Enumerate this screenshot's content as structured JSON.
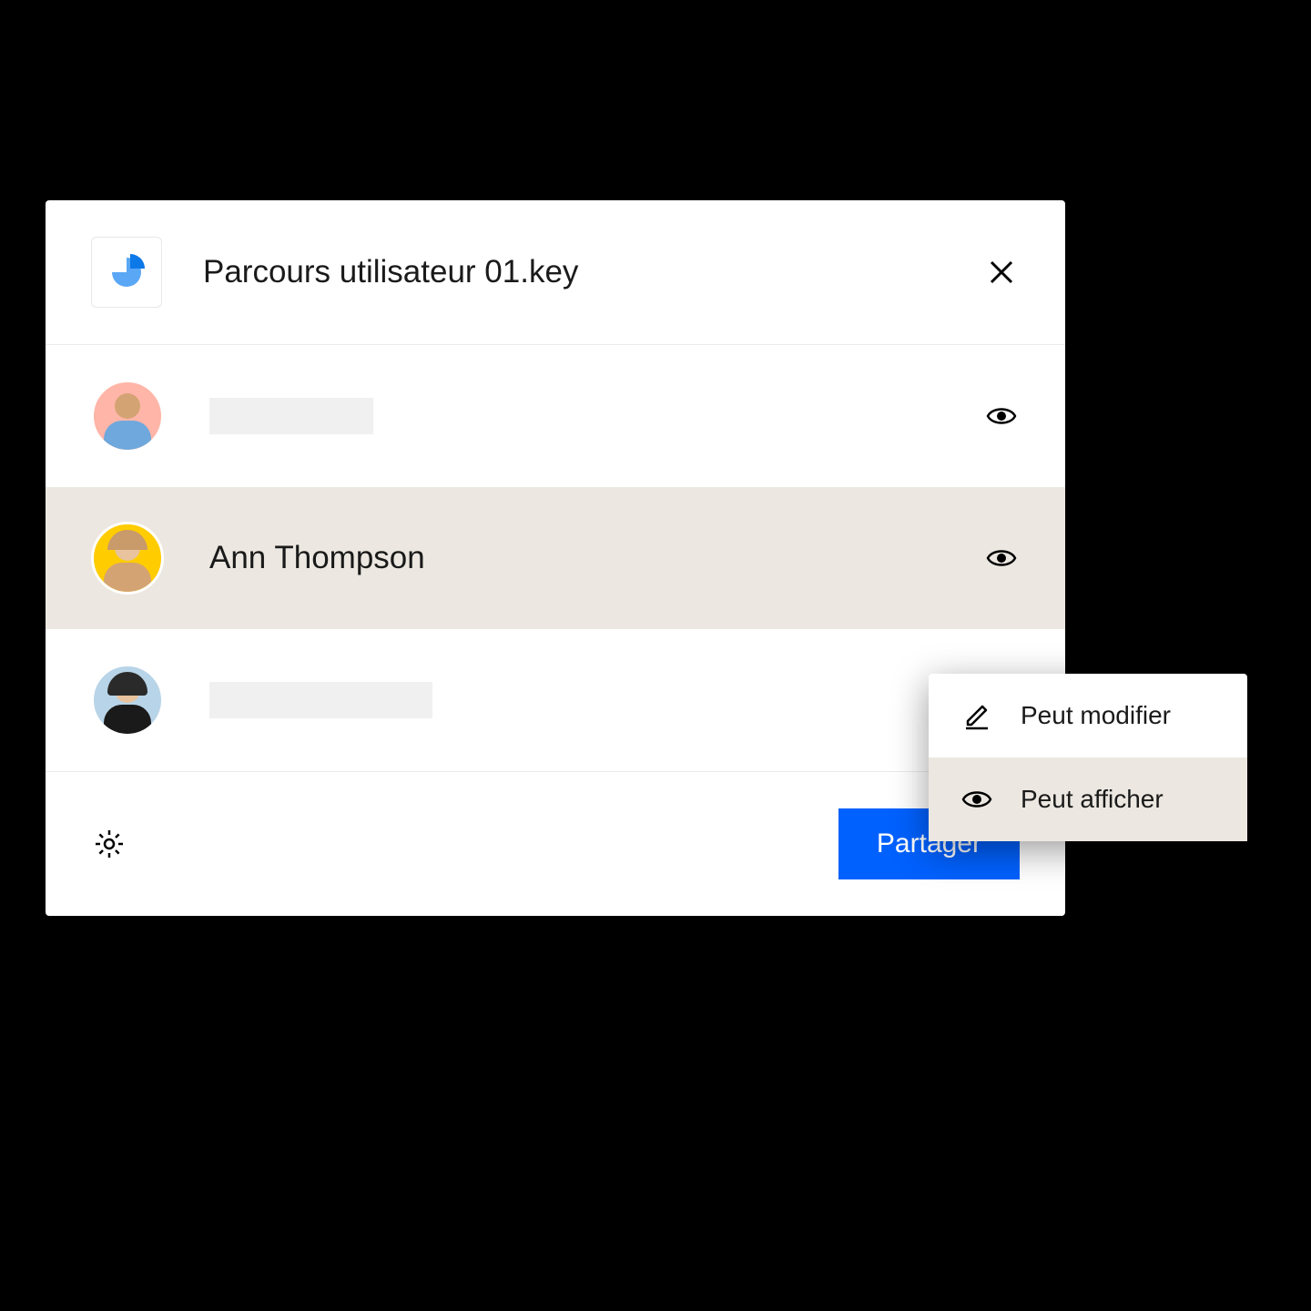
{
  "header": {
    "filename": "Parcours utilisateur 01.key",
    "file_icon": "pie-chart-icon",
    "close_icon": "close-icon"
  },
  "users": [
    {
      "name": "",
      "avatar_color": "pink",
      "permission_icon": "eye-icon",
      "placeholder": true
    },
    {
      "name": "Ann Thompson",
      "avatar_color": "yellow",
      "permission_icon": "eye-icon",
      "highlighted": true
    },
    {
      "name": "",
      "avatar_color": "blue",
      "permission_icon": "",
      "placeholder": true,
      "placeholder_wider": true
    }
  ],
  "footer": {
    "settings_icon": "gear-icon",
    "share_label": "Partager"
  },
  "dropdown": {
    "items": [
      {
        "icon": "pencil-icon",
        "label": "Peut modifier",
        "selected": false
      },
      {
        "icon": "eye-icon",
        "label": "Peut afficher",
        "selected": true
      }
    ]
  },
  "colors": {
    "accent": "#0061fe",
    "highlight_bg": "#ece8e1"
  }
}
